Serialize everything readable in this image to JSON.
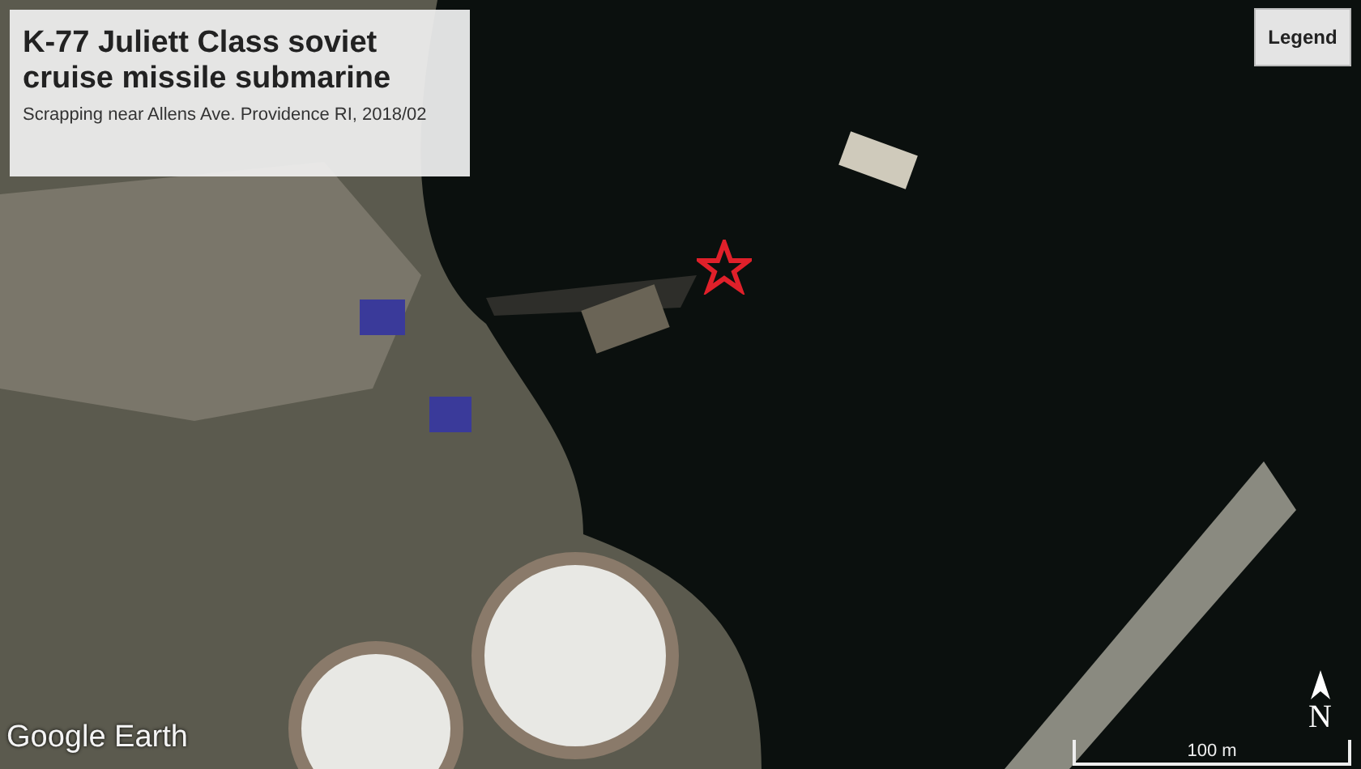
{
  "info_card": {
    "title": "K-77 Juliett Class soviet cruise missile submarine",
    "subtitle": "Scrapping near Allens Ave. Providence RI, 2018/02"
  },
  "legend_button": {
    "label": "Legend"
  },
  "logo": {
    "text": "Google Earth"
  },
  "compass": {
    "label": "N"
  },
  "scale_bar": {
    "label": "100 m"
  }
}
